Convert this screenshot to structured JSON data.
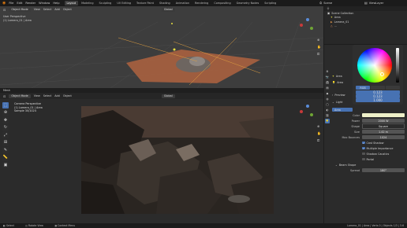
{
  "topbar": {
    "menus": [
      "File",
      "Edit",
      "Render",
      "Window",
      "Help"
    ],
    "workspaces": [
      "Layout",
      "Modeling",
      "Sculpting",
      "UV Editing",
      "Texture Paint",
      "Shading",
      "Animation",
      "Rendering",
      "Compositing",
      "Geometry Nodes",
      "Scripting"
    ],
    "active_workspace": "Layout",
    "scene": "Scene",
    "view_layer": "ViewLayer"
  },
  "viewport_top": {
    "mode": "Object Mode",
    "menus": [
      "View",
      "Select",
      "Add",
      "Object"
    ],
    "orientation": "Global",
    "overlay_text": [
      "User Perspective",
      "(1) Lamera_01 | Area"
    ]
  },
  "timeline_strip": {
    "label": "Mesh"
  },
  "viewport_bottom": {
    "mode": "Object Mode",
    "menus": [
      "View",
      "Select",
      "Add",
      "Object"
    ],
    "orientation": "Global",
    "overlay_text": [
      "Camera Perspective",
      "(1) Lamera_01 | Area",
      "Sample 30/1024"
    ]
  },
  "outliner": {
    "title": "Scene Collection",
    "items": [
      "Area",
      "Lamera_01",
      "..."
    ]
  },
  "properties": {
    "object_name": "Area",
    "light_header": "Area",
    "light_types": [
      "Point",
      "Sun",
      "Spot",
      "Area"
    ],
    "active_light_type": "Area",
    "preview_label": "Preview",
    "light_label": "Light",
    "color_values": {
      "r": "0.123",
      "g": "0.123",
      "b": "1.000"
    },
    "color_mode": "RGB",
    "fields": [
      {
        "label": "Color",
        "value": ""
      },
      {
        "label": "Power",
        "value": "2000 W"
      },
      {
        "label": "Shape",
        "value": "Square"
      },
      {
        "label": "Size",
        "value": "1.42 m"
      },
      {
        "label": "Max Bounces",
        "value": "1024"
      }
    ],
    "checks": [
      {
        "label": "Cast Shadow",
        "on": true
      },
      {
        "label": "Multiple Importance",
        "on": true
      },
      {
        "label": "Shadow Caustics",
        "on": false
      },
      {
        "label": "Portal",
        "on": false
      }
    ],
    "beam_shape_label": "Beam Shape",
    "spread_label": "Spread",
    "spread_value": "180°"
  },
  "statusbar": {
    "left": [
      "Select",
      "Rotate View",
      "Context Menu"
    ],
    "right": "Lamera_01 | Area | Verts 0 | Objects 1/3 | 3.6"
  },
  "colors": {
    "accent": "#4772b3",
    "bg": "#1d1d1d",
    "floor": "#b06a4a"
  }
}
